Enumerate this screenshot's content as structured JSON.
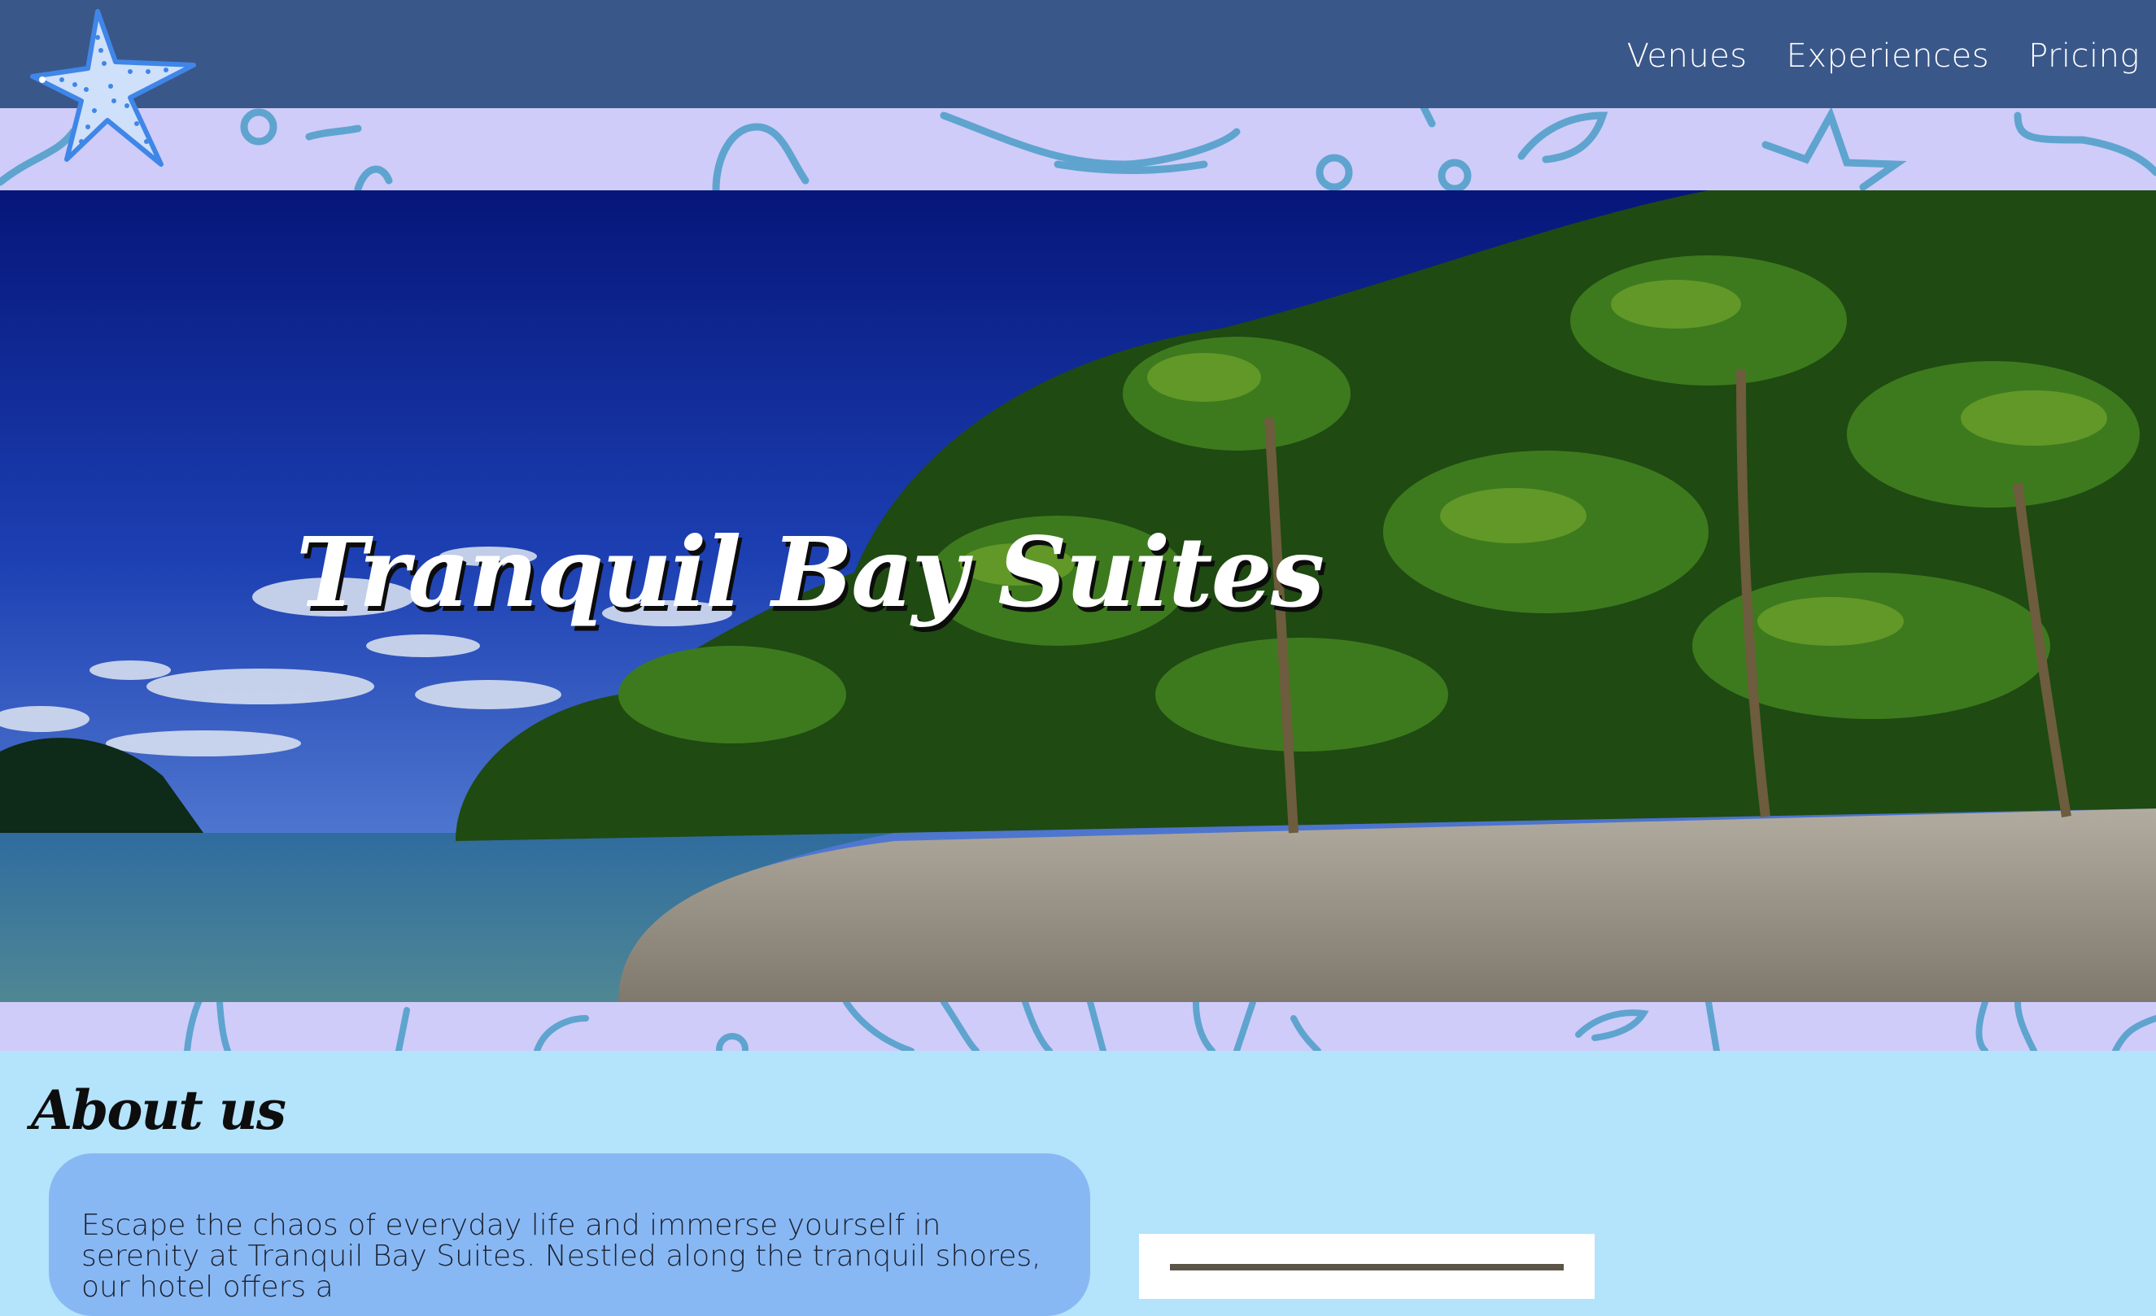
{
  "brand": {
    "logo_icon": "starfish-icon"
  },
  "nav": {
    "items": [
      {
        "label": "Venues"
      },
      {
        "label": "Experiences"
      },
      {
        "label": "Pricing"
      }
    ]
  },
  "hero": {
    "title": "Tranquil Bay Suites",
    "image_icon": "tropical-beach-photo"
  },
  "about": {
    "heading": "About us",
    "text": "Escape the chaos of everyday life and immerse yourself in serenity at Tranquil Bay Suites. Nestled along the tranquil shores, our hotel offers a"
  },
  "colors": {
    "header_bg": "#3a5789",
    "pattern_bg": "#cfccf9",
    "pattern_stroke": "#5ea4cf",
    "page_bg": "#b4e3fc",
    "card_bg": "#88b8f4"
  }
}
